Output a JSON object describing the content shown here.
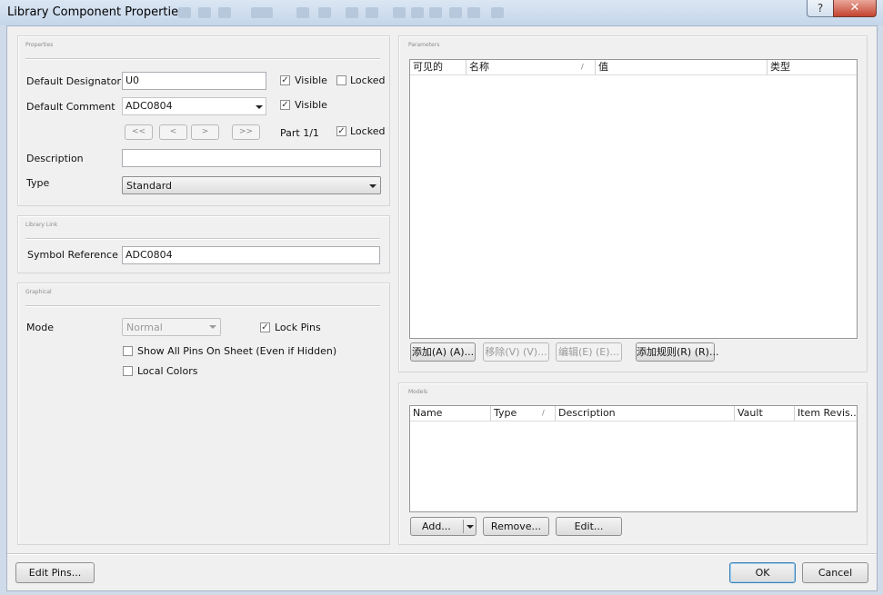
{
  "window": {
    "title": "Library Component Properties",
    "help_glyph": "?",
    "close_glyph": "✕"
  },
  "properties": {
    "section_title": "Properties",
    "designator_label": "Default Designator",
    "designator_value": "U0",
    "designator_visible_label": "Visible",
    "designator_visible": true,
    "designator_locked_label": "Locked",
    "designator_locked": false,
    "comment_label": "Default Comment",
    "comment_value": "ADC0804",
    "comment_visible_label": "Visible",
    "comment_visible": true,
    "nav_first": "<<",
    "nav_prev": "<",
    "nav_next": ">",
    "nav_last": ">>",
    "part_label": "Part 1/1",
    "part_locked_label": "Locked",
    "part_locked": true,
    "description_label": "Description",
    "description_value": "",
    "type_label": "Type",
    "type_value": "Standard"
  },
  "library_link": {
    "section_title": "Library Link",
    "symbol_label": "Symbol Reference",
    "symbol_value": "ADC0804"
  },
  "graphical": {
    "section_title": "Graphical",
    "mode_label": "Mode",
    "mode_value": "Normal",
    "lock_pins_label": "Lock Pins",
    "lock_pins": true,
    "show_all_pins_label": "Show All Pins On Sheet (Even if Hidden)",
    "show_all_pins": false,
    "local_colors_label": "Local Colors",
    "local_colors": false
  },
  "parameters": {
    "section_title": "Parameters",
    "columns": [
      "可见的",
      "名称",
      "值",
      "类型"
    ],
    "sort_glyph": "/",
    "add_button": "添加(A) (A)...",
    "remove_button": "移除(V) (V)...",
    "edit_button": "编辑(E) (E)...",
    "add_rule_button": "添加规则(R) (R)..."
  },
  "models": {
    "section_title": "Models",
    "columns": [
      "Name",
      "Type",
      "Description",
      "Vault",
      "Item Revis..."
    ],
    "sort_glyph": "/",
    "add_button": "Add...",
    "remove_button": "Remove...",
    "edit_button": "Edit..."
  },
  "footer": {
    "edit_pins_button": "Edit Pins...",
    "ok_button": "OK",
    "cancel_button": "Cancel"
  },
  "colors": {
    "titlebar": "#c5d6ea",
    "close_button": "#c4432f",
    "dialog_bg": "#f0f0f0"
  }
}
